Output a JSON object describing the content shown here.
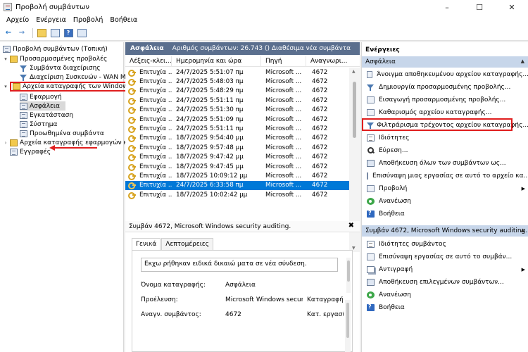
{
  "window": {
    "title": "Προβολή συμβάντων",
    "controls": {
      "minimize": "–",
      "maximize": "☐",
      "close": "✕"
    }
  },
  "menu": [
    "Αρχείο",
    "Ενέργεια",
    "Προβολή",
    "Βοήθεια"
  ],
  "toolbar": {
    "back": "←",
    "forward": "→",
    "help": "?"
  },
  "tree": {
    "root": "Προβολή συμβάντων (Τοπική)",
    "custom_views": "Προσαρμοσμένες προβολές",
    "admin_events": "Συμβάντα διαχείρισης",
    "device_mgmt": "Διαχείριση Συσκευών - WAN Min",
    "windows_logs": "Αρχεία καταγραφής των Windows",
    "application": "Εφαρμογή",
    "security": "Ασφάλεια",
    "setup": "Εγκατάσταση",
    "system": "Σύστημα",
    "forwarded": "Προωθημένα συμβάντα",
    "app_services": "Αρχεία καταγραφής εφαρμογών και",
    "subscriptions": "Εγγραφές"
  },
  "log_view": {
    "name": "Ασφάλεια",
    "count_text": "Αριθμός συμβάντων: 26.743 () Διαθέσιμα νέα συμβάντα",
    "columns": [
      "Λέξεις-κλει...",
      "Ημερομηνία και ώρα",
      "Πηγή",
      "Αναγνωρι..."
    ],
    "rows": [
      {
        "keyword": "Επιτυχία ...",
        "datetime": "24/7/2025 5:51:07 πμ",
        "source": "Microsoft ...",
        "id": "4672"
      },
      {
        "keyword": "Επιτυχία ...",
        "datetime": "24/7/2025 5:48:03 πμ",
        "source": "Microsoft ...",
        "id": "4672"
      },
      {
        "keyword": "Επιτυχία ...",
        "datetime": "24/7/2025 5:48:29 πμ",
        "source": "Microsoft ...",
        "id": "4672"
      },
      {
        "keyword": "Επιτυχία ...",
        "datetime": "24/7/2025 5:51:11 πμ",
        "source": "Microsoft ...",
        "id": "4672"
      },
      {
        "keyword": "Επιτυχία ...",
        "datetime": "24/7/2025 5:51:30 πμ",
        "source": "Microsoft ...",
        "id": "4672"
      },
      {
        "keyword": "Επιτυχία ...",
        "datetime": "24/7/2025 5:51:09 πμ",
        "source": "Microsoft ...",
        "id": "4672"
      },
      {
        "keyword": "Επιτυχία ...",
        "datetime": "24/7/2025 5:51:11 πμ",
        "source": "Microsoft ...",
        "id": "4672"
      },
      {
        "keyword": "Επιτυχία ...",
        "datetime": "18/7/2025 9:54:40 μμ",
        "source": "Microsoft ...",
        "id": "4672"
      },
      {
        "keyword": "Επιτυχία ...",
        "datetime": "18/7/2025 9:57:48 μμ",
        "source": "Microsoft ...",
        "id": "4672"
      },
      {
        "keyword": "Επιτυχία ...",
        "datetime": "18/7/2025 9:47:42 μμ",
        "source": "Microsoft ...",
        "id": "4672"
      },
      {
        "keyword": "Επιτυχία ...",
        "datetime": "18/7/2025 9:47:45 μμ",
        "source": "Microsoft ...",
        "id": "4672"
      },
      {
        "keyword": "Επιτυχία ...",
        "datetime": "18/7/2025 10:09:12 μμ",
        "source": "Microsoft ...",
        "id": "4672"
      },
      {
        "keyword": "Επιτυχία ...",
        "datetime": "24/7/2025 6:33:58 πμ",
        "source": "Microsoft ...",
        "id": "4672"
      },
      {
        "keyword": "Επιτυχία ...",
        "datetime": "18/7/2025 10:02:42 μμ",
        "source": "Microsoft ...",
        "id": "4672"
      }
    ]
  },
  "details": {
    "header": "Συμβάν 4672, Microsoft Windows security auditing.",
    "close": "✖",
    "tabs": [
      "Γενικά",
      "Λεπτομέρειες"
    ],
    "description": "Εκχω ρήθηκαν ειδικά δικαιώ ματα σε νέα σύνδεση.",
    "labels": {
      "log_name": "Όνομα καταγραφής:",
      "source": "Προέλευση:",
      "event_id": "Αναγν. συμβάντος:",
      "logged": "Καταγραφή:",
      "task": "Κατ. εργασίας:"
    },
    "values": {
      "log_name": "Ασφάλεια",
      "source": "Microsoft Windows security a",
      "event_id": "4672"
    }
  },
  "actions": {
    "title": "Ενέργειες",
    "section1": "Ασφάλεια",
    "section1_items": [
      "Άνοιγμα αποθηκευμένου αρχείου καταγραφής...",
      "Δημιουργία προσαρμοσμένης προβολής...",
      "Εισαγωγή προσαρμοσμένης προβολής...",
      "Καθαρισμός αρχείου καταγραφής...",
      "Φιλτράρισμα τρέχοντος αρχείου καταγραφής...",
      "Ιδιότητες",
      "Εύρεση...",
      "Αποθήκευση όλων των συμβάντων ως...",
      "Επισύναψη μιας εργασίας σε αυτό το αρχείο κα...",
      "Προβολή",
      "Ανανέωση",
      "Βοήθεια"
    ],
    "section2": "Συμβάν 4672, Microsoft Windows security auditing.",
    "section2_items": [
      "Ιδιότητες συμβάντος",
      "Επισύναψη εργασίας σε αυτό το συμβάν...",
      "Αντιγραφή",
      "Αποθήκευση επιλεγμένων συμβάντων...",
      "Ανανέωση",
      "Βοήθεια"
    ]
  }
}
